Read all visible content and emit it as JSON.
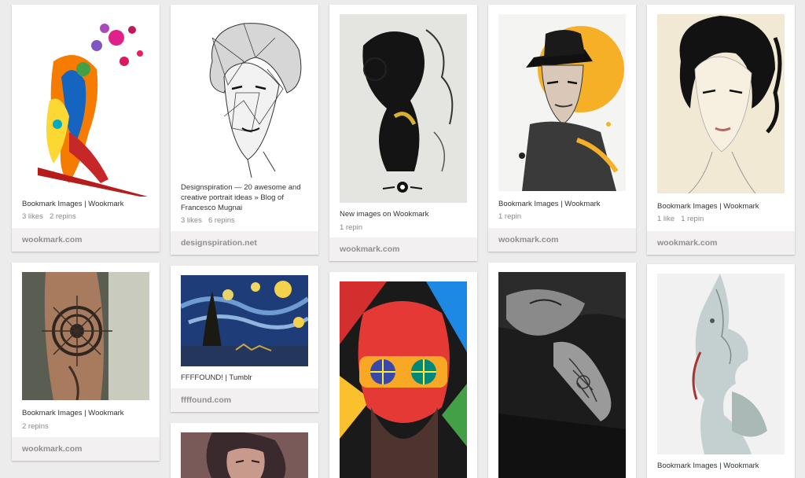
{
  "pins": [
    {
      "description": "Bookmark Images | Wookmark",
      "likes": "3 likes",
      "repins": "2 repins",
      "source": "wookmark.com",
      "image": "colorful-splash-dancer"
    },
    {
      "description": "Designspiration — 20 awesome and creative portrait ideas » Blog of Francesco Mugnai",
      "likes": "3 likes",
      "repins": "6 repins",
      "source": "designspiration.net",
      "image": "geometric-marilyn-portrait"
    },
    {
      "description": "New images on Wookmark",
      "likes": "",
      "repins": "1 repin",
      "source": "wookmark.com",
      "image": "ink-collage-portrait"
    },
    {
      "description": "Bookmark Images | Wookmark",
      "likes": "",
      "repins": "1 repin",
      "source": "wookmark.com",
      "image": "man-in-fedora"
    },
    {
      "description": "Bookmark Images | Wookmark",
      "likes": "1 like",
      "repins": "1 repin",
      "source": "wookmark.com",
      "image": "ink-woman-portrait"
    },
    {
      "description": "Bookmark Images | Wookmark",
      "likes": "",
      "repins": "2 repins",
      "source": "wookmark.com",
      "image": "forearm-mandala-tattoo"
    },
    {
      "description": "FFFFOUND! | Tumblr",
      "likes": "",
      "repins": "",
      "source": "ffffound.com",
      "image": "starry-night-painting"
    },
    {
      "description": "",
      "likes": "",
      "repins": "",
      "source": "",
      "image": "pop-art-bearded-man"
    },
    {
      "description": "",
      "likes": "",
      "repins": "",
      "source": "",
      "image": "hands-tattoo-photo"
    },
    {
      "description": "Bookmark Images | Wookmark",
      "likes": "",
      "repins": "",
      "source": "",
      "image": "double-exposure-profile"
    },
    {
      "description": "",
      "likes": "",
      "repins": "",
      "source": "",
      "image": "painted-woman-portrait"
    }
  ]
}
